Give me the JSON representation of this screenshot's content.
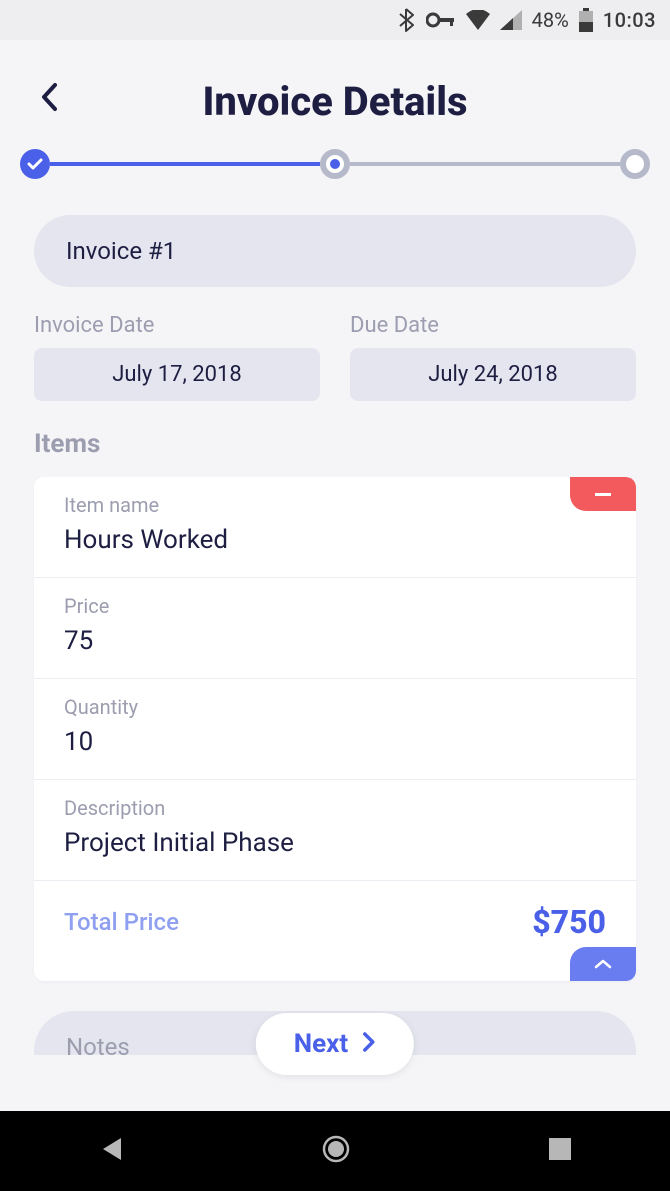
{
  "status": {
    "battery_pct": "48%",
    "clock": "10:03"
  },
  "header": {
    "title": "Invoice Details"
  },
  "invoice": {
    "number_label": "Invoice #1",
    "date_label": "Invoice Date",
    "date_value": "July 17, 2018",
    "due_label": "Due Date",
    "due_value": "July 24, 2018"
  },
  "items_section": {
    "title": "Items"
  },
  "item": {
    "name_label": "Item name",
    "name_value": "Hours Worked",
    "price_label": "Price",
    "price_value": "75",
    "qty_label": "Quantity",
    "qty_value": "10",
    "desc_label": "Description",
    "desc_value": "Project Initial Phase",
    "total_label": "Total Price",
    "total_value": "$750"
  },
  "next": {
    "label": "Next"
  },
  "notes": {
    "label": "Notes"
  }
}
